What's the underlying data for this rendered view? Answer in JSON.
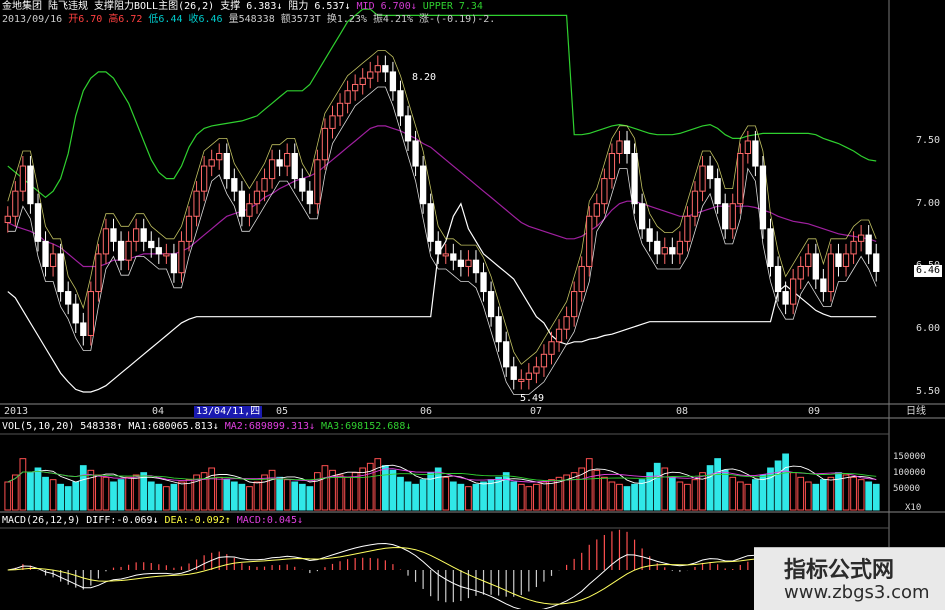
{
  "header": {
    "line1": [
      {
        "text": "金地集团",
        "color": "#ffffff"
      },
      {
        "text": "陆飞违规",
        "color": "#ffffff"
      },
      {
        "text": "支撑阻力BOLL主图(26,2)",
        "color": "#ffffff"
      },
      {
        "text": "支撑 6.383↓",
        "color": "#ffffff"
      },
      {
        "text": "阻力 6.537↓",
        "color": "#ffffff"
      },
      {
        "text": "MID 6.700↓",
        "color": "#d23bd2"
      },
      {
        "text": "UPPER 7.34",
        "color": "#2fd02f"
      }
    ],
    "line2": [
      {
        "text": "2013/09/16",
        "color": "#cccccc"
      },
      {
        "text": "开6.70",
        "color": "#ff4040"
      },
      {
        "text": "高6.72",
        "color": "#ff4040"
      },
      {
        "text": "低6.44",
        "color": "#00cccc"
      },
      {
        "text": "收6.46",
        "color": "#00cccc"
      },
      {
        "text": "量548338",
        "color": "#cccccc"
      },
      {
        "text": "额3573T",
        "color": "#cccccc"
      },
      {
        "text": "换1.23%",
        "color": "#cccccc"
      },
      {
        "text": "振4.21%",
        "color": "#cccccc"
      },
      {
        "text": "涨-(-0.19)-2.",
        "color": "#cccccc"
      }
    ]
  },
  "price_axis": {
    "labels": [
      "7.50",
      "7.00",
      "6.50",
      "6.00",
      "5.50"
    ],
    "current_label": "6.46"
  },
  "annotations": {
    "high": "8.20",
    "low": "5.49"
  },
  "date_axis": {
    "labels": [
      "2013",
      "04",
      "13/04/11,四",
      "05",
      "06",
      "07",
      "08",
      "09"
    ],
    "period_label": "日线"
  },
  "vol_header": {
    "items": [
      {
        "text": "VOL(5,10,20)  548338↑",
        "color": "#ffffff"
      },
      {
        "text": "MA1:680065.813↓",
        "color": "#ffffff"
      },
      {
        "text": "MA2:689899.313↓",
        "color": "#e040e0"
      },
      {
        "text": "MA3:698152.688↓",
        "color": "#30d030"
      }
    ],
    "axis": [
      "150000",
      "100000",
      "50000"
    ],
    "scale_label": "X10"
  },
  "macd_header": {
    "items": [
      {
        "text": "MACD(26,12,9)",
        "color": "#ffffff"
      },
      {
        "text": "DIFF:-0.069↓",
        "color": "#ffffff"
      },
      {
        "text": "DEA:-0.092↑",
        "color": "#ffff40"
      },
      {
        "text": "MACD:0.045↓",
        "color": "#e040e0"
      }
    ]
  },
  "watermark": {
    "title": "指标公式网",
    "url": "www.zbgs3.com"
  },
  "colors": {
    "up": "#ff6a6a",
    "down": "#ffffff",
    "vol_up": "#ff5050",
    "vol_down": "#30e8e8",
    "upper": "#2fd02f",
    "mid": "#a020a0",
    "lower": "#ffffff",
    "support": "#ffffff",
    "resistance": "#ffff80"
  },
  "chart_data": {
    "type": "candlestick",
    "title": "金地集团",
    "xlabel": "",
    "ylabel": "",
    "ylim": [
      5.42,
      8.4
    ],
    "date_range": [
      "2013-01",
      "2013-09-16"
    ],
    "closes": [
      6.9,
      7.1,
      7.3,
      7.0,
      6.7,
      6.5,
      6.6,
      6.3,
      6.2,
      6.05,
      5.95,
      6.3,
      6.6,
      6.8,
      6.7,
      6.55,
      6.7,
      6.8,
      6.7,
      6.65,
      6.6,
      6.6,
      6.45,
      6.7,
      6.9,
      7.1,
      7.3,
      7.35,
      7.4,
      7.2,
      7.1,
      6.9,
      7.0,
      7.1,
      7.2,
      7.35,
      7.3,
      7.4,
      7.2,
      7.1,
      7.0,
      7.35,
      7.6,
      7.7,
      7.8,
      7.9,
      7.95,
      8.0,
      8.05,
      8.1,
      8.05,
      7.9,
      7.7,
      7.5,
      7.3,
      7.0,
      6.7,
      6.6,
      6.6,
      6.55,
      6.5,
      6.55,
      6.45,
      6.3,
      6.1,
      5.9,
      5.7,
      5.6,
      5.6,
      5.65,
      5.7,
      5.8,
      5.9,
      6.0,
      6.1,
      6.3,
      6.5,
      6.9,
      7.0,
      7.2,
      7.4,
      7.5,
      7.4,
      7.0,
      6.8,
      6.7,
      6.6,
      6.65,
      6.6,
      6.7,
      6.9,
      7.1,
      7.3,
      7.2,
      7.0,
      6.8,
      7.0,
      7.4,
      7.5,
      7.3,
      6.8,
      6.5,
      6.3,
      6.2,
      6.4,
      6.5,
      6.6,
      6.4,
      6.3,
      6.6,
      6.5,
      6.6,
      6.7,
      6.75,
      6.6,
      6.46
    ],
    "volume": [
      60,
      75,
      110,
      80,
      90,
      70,
      65,
      55,
      50,
      60,
      95,
      85,
      75,
      70,
      60,
      65,
      70,
      75,
      80,
      60,
      55,
      50,
      55,
      60,
      65,
      75,
      80,
      90,
      70,
      65,
      60,
      55,
      50,
      60,
      75,
      85,
      70,
      65,
      60,
      55,
      50,
      80,
      95,
      85,
      75,
      70,
      80,
      90,
      100,
      110,
      95,
      85,
      70,
      60,
      55,
      65,
      80,
      90,
      70,
      60,
      55,
      50,
      55,
      60,
      65,
      70,
      80,
      60,
      55,
      50,
      55,
      60,
      65,
      70,
      75,
      80,
      90,
      110,
      85,
      70,
      60,
      55,
      50,
      55,
      65,
      80,
      100,
      90,
      70,
      60,
      55,
      65,
      80,
      95,
      110,
      85,
      70,
      60,
      55,
      65,
      75,
      90,
      105,
      120,
      80,
      70,
      60,
      55,
      65,
      70,
      80,
      75,
      70,
      65,
      60,
      55
    ],
    "series": [
      {
        "name": "UPPER",
        "values": [
          7.3,
          7.25,
          7.2,
          7.15,
          7.1,
          7.05,
          7.1,
          7.2,
          7.4,
          7.7,
          7.9,
          8.0,
          8.05,
          8.05,
          8.0,
          7.9,
          7.8,
          7.65,
          7.5,
          7.35,
          7.25,
          7.2,
          7.2,
          7.3,
          7.45,
          7.55,
          7.6,
          7.62,
          7.63,
          7.64,
          7.65,
          7.66,
          7.68,
          7.7,
          7.75,
          7.8,
          7.85,
          7.9,
          7.9,
          7.9,
          7.95,
          8.05,
          8.15,
          8.25,
          8.35,
          8.45,
          8.5,
          8.55,
          8.55,
          8.5,
          8.5,
          8.5,
          8.5,
          8.5,
          8.5,
          8.5,
          8.5,
          8.5,
          8.5,
          8.5,
          8.5,
          8.5,
          8.5,
          8.5,
          8.5,
          8.5,
          8.5,
          8.5,
          8.5,
          8.5,
          8.5,
          8.5,
          8.5,
          8.5,
          8.5,
          7.55,
          7.55,
          7.56,
          7.58,
          7.6,
          7.62,
          7.63,
          7.62,
          7.6,
          7.58,
          7.56,
          7.55,
          7.55,
          7.55,
          7.56,
          7.58,
          7.6,
          7.62,
          7.63,
          7.6,
          7.55,
          7.52,
          7.52,
          7.54,
          7.55,
          7.56,
          7.56,
          7.56,
          7.56,
          7.56,
          7.56,
          7.56,
          7.55,
          7.52,
          7.5,
          7.48,
          7.45,
          7.42,
          7.38,
          7.35,
          7.34
        ]
      },
      {
        "name": "MID",
        "values": [
          6.85,
          6.82,
          6.8,
          6.78,
          6.75,
          6.7,
          6.68,
          6.65,
          6.6,
          6.55,
          6.5,
          6.5,
          6.5,
          6.52,
          6.55,
          6.55,
          6.56,
          6.58,
          6.6,
          6.6,
          6.6,
          6.6,
          6.6,
          6.62,
          6.65,
          6.7,
          6.75,
          6.8,
          6.85,
          6.9,
          6.92,
          6.94,
          6.96,
          7.0,
          7.05,
          7.08,
          7.12,
          7.15,
          7.18,
          7.2,
          7.22,
          7.25,
          7.3,
          7.35,
          7.4,
          7.45,
          7.5,
          7.55,
          7.6,
          7.62,
          7.62,
          7.6,
          7.58,
          7.55,
          7.52,
          7.48,
          7.45,
          7.4,
          7.35,
          7.3,
          7.25,
          7.2,
          7.15,
          7.1,
          7.05,
          7.0,
          6.95,
          6.9,
          6.85,
          6.82,
          6.8,
          6.78,
          6.76,
          6.74,
          6.72,
          6.72,
          6.74,
          6.78,
          6.82,
          6.88,
          6.95,
          7.0,
          7.02,
          7.02,
          7.0,
          6.98,
          6.96,
          6.94,
          6.92,
          6.9,
          6.9,
          6.92,
          6.94,
          6.96,
          6.98,
          6.98,
          6.98,
          6.98,
          6.98,
          6.97,
          6.95,
          6.93,
          6.9,
          6.88,
          6.86,
          6.85,
          6.84,
          6.82,
          6.8,
          6.78,
          6.76,
          6.75,
          6.74,
          6.73,
          6.72,
          6.7
        ]
      },
      {
        "name": "LOWER",
        "values": [
          6.3,
          6.25,
          6.15,
          6.05,
          5.95,
          5.85,
          5.75,
          5.65,
          5.58,
          5.52,
          5.5,
          5.5,
          5.52,
          5.55,
          5.6,
          5.65,
          5.7,
          5.75,
          5.8,
          5.85,
          5.9,
          5.95,
          6.0,
          6.05,
          6.08,
          6.1,
          6.1,
          6.1,
          6.1,
          6.1,
          6.1,
          6.1,
          6.1,
          6.1,
          6.1,
          6.1,
          6.1,
          6.1,
          6.1,
          6.1,
          6.1,
          6.1,
          6.1,
          6.1,
          6.1,
          6.1,
          6.1,
          6.1,
          6.1,
          6.1,
          6.1,
          6.1,
          6.1,
          6.1,
          6.1,
          6.1,
          6.1,
          6.6,
          6.7,
          6.9,
          7.0,
          6.8,
          6.7,
          6.6,
          6.55,
          6.5,
          6.45,
          6.4,
          6.3,
          6.2,
          6.1,
          6.05,
          5.95,
          5.9,
          5.88,
          5.9,
          5.9,
          5.92,
          5.93,
          5.95,
          5.96,
          5.98,
          6.0,
          6.02,
          6.04,
          6.06,
          6.06,
          6.06,
          6.06,
          6.06,
          6.06,
          6.06,
          6.06,
          6.06,
          6.06,
          6.06,
          6.06,
          6.06,
          6.06,
          6.06,
          6.06,
          6.06,
          6.3,
          6.35,
          6.3,
          6.25,
          6.2,
          6.15,
          6.12,
          6.1,
          6.1,
          6.1,
          6.1,
          6.1,
          6.1,
          6.1
        ]
      }
    ],
    "support": 6.383,
    "resistance": 6.537,
    "macd": {
      "diff": -0.069,
      "dea": -0.092,
      "macd": 0.045
    }
  }
}
